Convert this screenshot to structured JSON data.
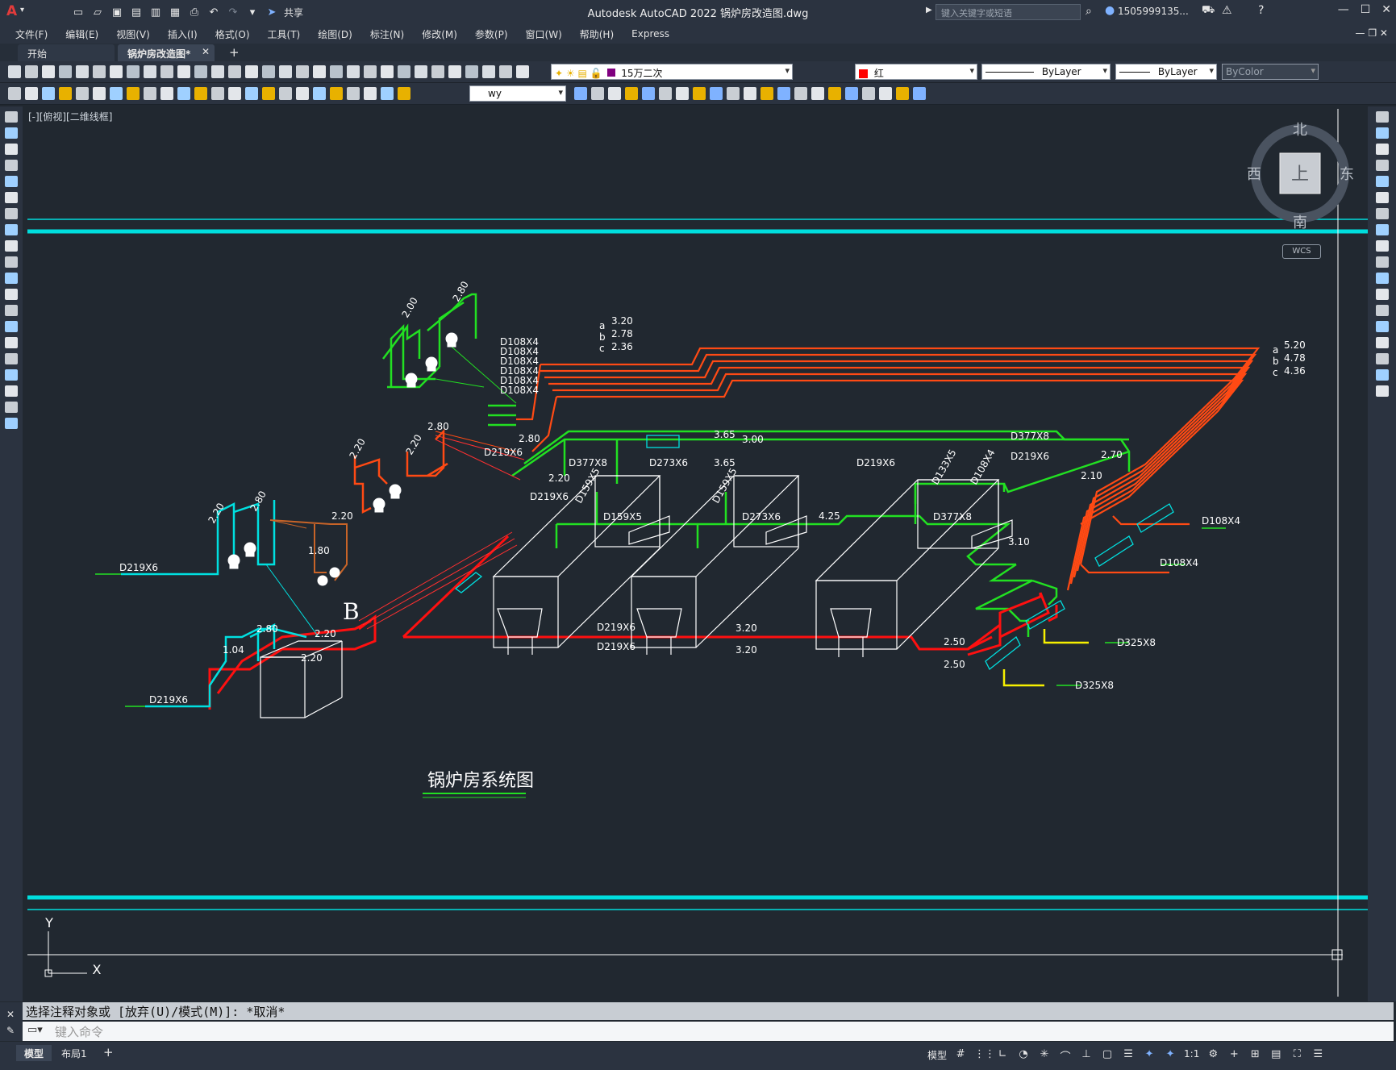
{
  "app": {
    "title": "Autodesk AutoCAD 2022    锅炉房改造图.dwg",
    "share_label": "共享",
    "search_placeholder": "键入关键字或短语",
    "user": "1505999135..."
  },
  "menu": [
    "文件(F)",
    "编辑(E)",
    "视图(V)",
    "插入(I)",
    "格式(O)",
    "工具(T)",
    "绘图(D)",
    "标注(N)",
    "修改(M)",
    "参数(P)",
    "窗口(W)",
    "帮助(H)",
    "Express"
  ],
  "file_tabs": [
    {
      "label": "开始",
      "active": false
    },
    {
      "label": "锅炉房改造图*",
      "active": true
    }
  ],
  "layers_toolbar": {
    "layer": "15万二次",
    "color": "红",
    "linetype": "ByLayer",
    "lineweight": "ByLayer",
    "plotstyle": "ByColor",
    "textstyle": "wy"
  },
  "viewport": {
    "label": "[-][俯视][二维线框]",
    "compass": {
      "n": "北",
      "s": "南",
      "e": "东",
      "w": "西",
      "top": "上",
      "wcs": "WCS"
    },
    "ucs": {
      "x": "X",
      "y": "Y"
    }
  },
  "drawing": {
    "title": "锅炉房系统图",
    "marker": "B",
    "labels": {
      "d108": "D108X4",
      "d219": "D219X6",
      "d377": "D377X8",
      "d273": "D273X6",
      "d159": "D159X5",
      "d133": "D133X5",
      "d325": "D325X8",
      "e520": "5.20",
      "e478": "4.78",
      "e436": "4.36",
      "e320": "3.20",
      "e278": "2.78",
      "e236": "2.36",
      "e365": "3.65",
      "e300": "3.00",
      "e280": "2.80",
      "e220": "2.20",
      "e200": "2.00",
      "e180": "1.80",
      "e104": "1.04",
      "e425": "4.25",
      "e310": "3.10",
      "e270": "2.70",
      "e210": "2.10",
      "e250": "2.50",
      "a": "a",
      "b": "b",
      "c": "c"
    }
  },
  "command": {
    "history": "选择注释对象或 [放弃(U)/模式(M)]: *取消*",
    "placeholder": "键入命令"
  },
  "layout_tabs": [
    "模型",
    "布局1"
  ],
  "status": {
    "model": "模型",
    "scale": "1:1"
  }
}
